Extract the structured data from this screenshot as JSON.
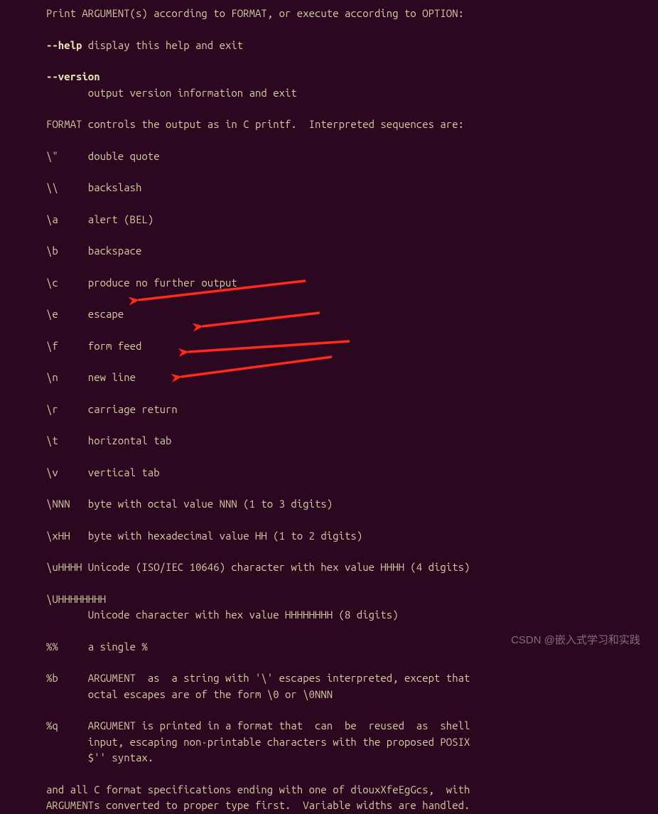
{
  "lines": {
    "l1": "Print ARGUMENT(s) according to FORMAT, or execute according to OPTION:",
    "l2": "",
    "l3a": "--help",
    "l3b": " display this help and exit",
    "l4": "",
    "l5": "--version",
    "l6": "       output version information and exit",
    "l7": "",
    "l8": "FORMAT controls the output as in C printf.  Interpreted sequences are:",
    "l9": "",
    "l10": "\\\"     double quote",
    "l11": "",
    "l12": "\\\\     backslash",
    "l13": "",
    "l14": "\\a     alert (BEL)",
    "l15": "",
    "l16": "\\b     backspace",
    "l17": "",
    "l18": "\\c     produce no further output",
    "l19": "",
    "l20": "\\e     escape",
    "l21": "",
    "l22": "\\f     form feed",
    "l23": "",
    "l24": "\\n     new line",
    "l25": "",
    "l26": "\\r     carriage return",
    "l27": "",
    "l28": "\\t     horizontal tab",
    "l29": "",
    "l30": "\\v     vertical tab",
    "l31": "",
    "l32": "\\NNN   byte with octal value NNN (1 to 3 digits)",
    "l33": "",
    "l34": "\\xHH   byte with hexadecimal value HH (1 to 2 digits)",
    "l35": "",
    "l36": "\\uHHHH Unicode (ISO/IEC 10646) character with hex value HHHH (4 digits)",
    "l37": "",
    "l38": "\\UHHHHHHHH",
    "l39": "       Unicode character with hex value HHHHHHHH (8 digits)",
    "l40": "",
    "l41": "%%     a single %",
    "l42": "",
    "l43": "%b     ARGUMENT  as  a string with '\\' escapes interpreted, except that",
    "l44": "       octal escapes are of the form \\0 or \\0NNN",
    "l45": "",
    "l46": "%q     ARGUMENT is printed in a format that  can  be  reused  as  shell",
    "l47": "       input, escaping non-printable characters with the proposed POSIX",
    "l48": "       $'' syntax.",
    "l49": "",
    "l50": "and all C format specifications ending with one of diouxXfeEgGcs,  with",
    "l51": "ARGUMENTs converted to proper type first.  Variable widths are handled."
  },
  "watermark": "CSDN @嵌入式学习和实践"
}
